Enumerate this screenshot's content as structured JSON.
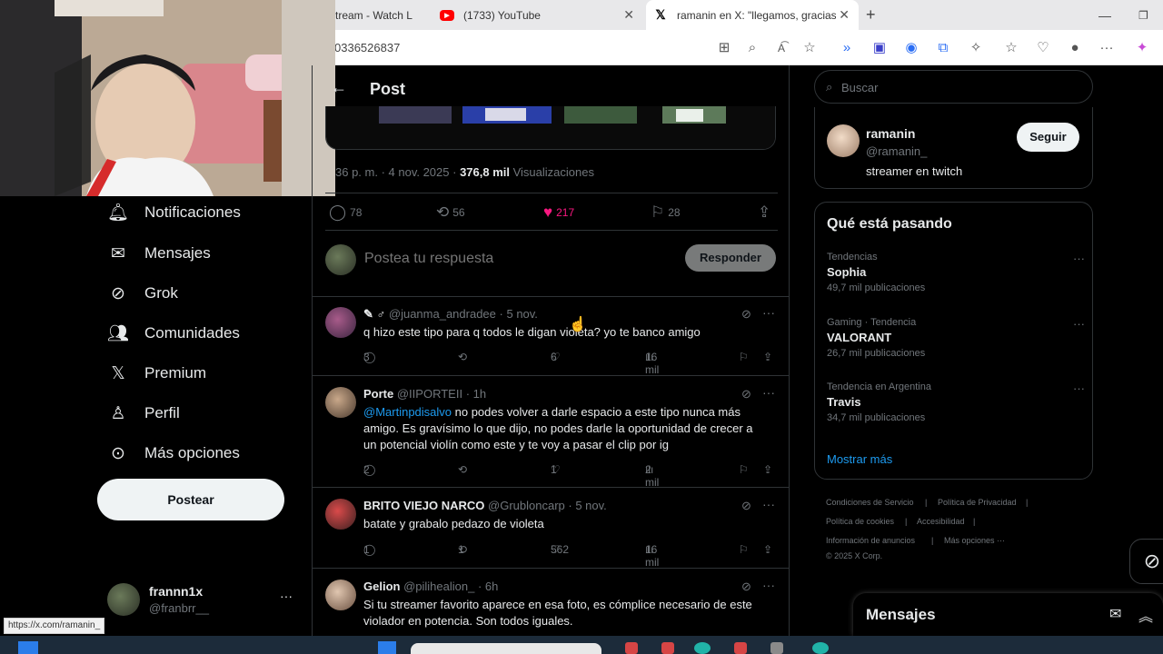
{
  "browser": {
    "tabs": [
      {
        "title": "tream - Watch L",
        "icon": "twitch-icon"
      },
      {
        "title": "(1733) YouTube",
        "icon": "youtube-icon"
      },
      {
        "title": "ramanin en X: \"llegamos, gracias.",
        "icon": "x-icon"
      }
    ],
    "new_tab_label": "+",
    "address": "0336526837",
    "status_url": "https://x.com/ramanin_"
  },
  "sidebar": {
    "items": [
      {
        "label": "Notificaciones",
        "icon": "bell-icon"
      },
      {
        "label": "Mensajes",
        "icon": "envelope-icon"
      },
      {
        "label": "Grok",
        "icon": "grok-icon"
      },
      {
        "label": "Comunidades",
        "icon": "people-icon"
      },
      {
        "label": "Premium",
        "icon": "x-logo-icon"
      },
      {
        "label": "Perfil",
        "icon": "person-icon"
      },
      {
        "label": "Más opciones",
        "icon": "more-circle-icon"
      }
    ],
    "post_button": "Postear",
    "account": {
      "name": "frannn1x",
      "handle": "@franbrr__"
    }
  },
  "post": {
    "header": "Post",
    "meta_time": "36 p. m. · 4 nov. 2025 · ",
    "views_count": "376,8 mil",
    "views_label": " Visualizaciones",
    "stats": {
      "replies": "78",
      "reposts": "56",
      "likes": "217",
      "bookmarks": "28"
    },
    "reply_placeholder": "Postea tu respuesta",
    "reply_button": "Responder"
  },
  "replies": [
    {
      "name": "✎ ♂",
      "handle": "@juanma_andradee",
      "time": "· 5 nov.",
      "mention": "",
      "text": "q hizo este tipo para q todos le digan violeta? yo te banco amigo",
      "replies": "3",
      "reposts": "",
      "likes": "6",
      "views": "16 mil"
    },
    {
      "name": "Porte",
      "handle": "@IIPORTEII",
      "time": "· 1h",
      "mention": "@Martinpdisalvo",
      "text": " no podes volver a darle espacio a este tipo nunca más amigo. Es gravísimo lo que dijo, no podes darle la oportunidad de crecer a un potencial violín como este y te voy a pasar el clip por ig",
      "replies": "2",
      "reposts": "",
      "likes": "1",
      "views": "2 mil"
    },
    {
      "name": "BRITO VIEJO NARCO",
      "handle": "@Grubloncarp",
      "time": "· 5 nov.",
      "mention": "",
      "text": "batate y grabalo pedazo de violeta",
      "replies": "1",
      "reposts": "1",
      "likes": "562",
      "views": "16 mil"
    },
    {
      "name": "Gelion",
      "handle": "@pilihealion_",
      "time": "· 6h",
      "mention": "",
      "text": "Si tu streamer favorito aparece en esa foto, es cómplice necesario de este violador en potencia. Son todos iguales.",
      "replies": "",
      "reposts": "",
      "likes": "",
      "views": ""
    }
  ],
  "right": {
    "search_placeholder": "Buscar",
    "profile": {
      "name": "ramanin",
      "handle": "@ramanin_",
      "bio": "streamer en twitch",
      "follow": "Seguir"
    },
    "trends_title": "Qué está pasando",
    "trends": [
      {
        "context": "Tendencias",
        "name": "Sophia",
        "posts": "49,7 mil publicaciones"
      },
      {
        "context": "Gaming · Tendencia",
        "name": "VALORANT",
        "posts": "26,7 mil publicaciones"
      },
      {
        "context": "Tendencia en Argentina",
        "name": "Travis",
        "posts": "34,7 mil publicaciones"
      }
    ],
    "show_more": "Mostrar más",
    "footer": [
      "Condiciones de Servicio",
      "Política de Privacidad",
      "Política de cookies",
      "Accesibilidad",
      "Información de anuncios",
      "Más opciones ···",
      "© 2025 X Corp."
    ],
    "messages_drawer": "Mensajes"
  },
  "colors": {
    "accent": "#1d9bf0",
    "like": "#f91880",
    "background": "#000000"
  }
}
